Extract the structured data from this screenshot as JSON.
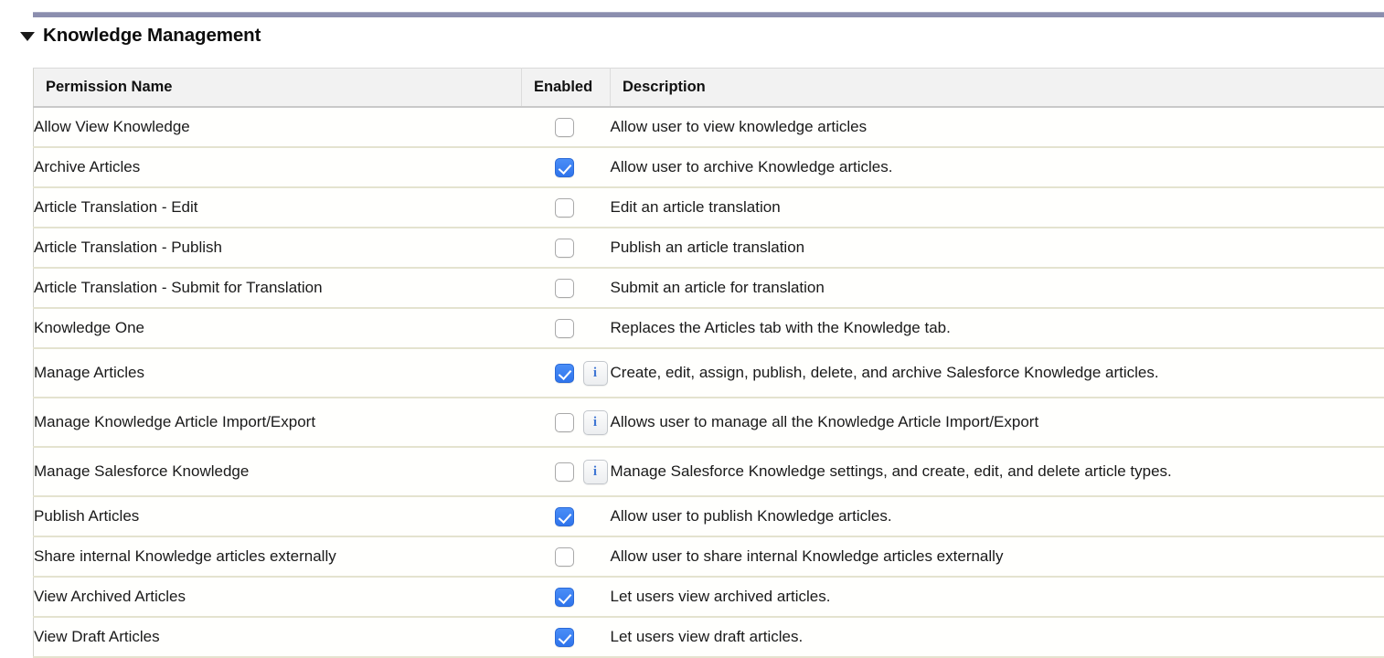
{
  "section": {
    "title": "Knowledge Management",
    "disclosure_icon": "triangle-down-icon",
    "expanded": true,
    "accent_color": "#8b8eae"
  },
  "table": {
    "columns": [
      {
        "key": "name",
        "label": "Permission Name"
      },
      {
        "key": "enabled",
        "label": "Enabled"
      },
      {
        "key": "description",
        "label": "Description"
      }
    ],
    "checkbox_checked_color": "#3b82f6",
    "info_icon_color": "#3f76d4",
    "row_divider_color": "#e4e3cf",
    "rows": [
      {
        "name": "Allow View Knowledge",
        "enabled": false,
        "has_info": false,
        "description": "Allow user to view knowledge articles"
      },
      {
        "name": "Archive Articles",
        "enabled": true,
        "has_info": false,
        "description": "Allow user to archive Knowledge articles."
      },
      {
        "name": "Article Translation - Edit",
        "enabled": false,
        "has_info": false,
        "description": "Edit an article translation"
      },
      {
        "name": "Article Translation - Publish",
        "enabled": false,
        "has_info": false,
        "description": "Publish an article translation"
      },
      {
        "name": "Article Translation - Submit for Translation",
        "enabled": false,
        "has_info": false,
        "description": "Submit an article for translation"
      },
      {
        "name": "Knowledge One",
        "enabled": false,
        "has_info": false,
        "description": "Replaces the Articles tab with the Knowledge tab."
      },
      {
        "name": "Manage Articles",
        "enabled": true,
        "has_info": true,
        "description": "Create, edit, assign, publish, delete, and archive Salesforce Knowledge articles."
      },
      {
        "name": "Manage Knowledge Article Import/Export",
        "enabled": false,
        "has_info": true,
        "description": "Allows user to manage all the Knowledge Article Import/Export"
      },
      {
        "name": "Manage Salesforce Knowledge",
        "enabled": false,
        "has_info": true,
        "description": "Manage Salesforce Knowledge settings, and create, edit, and delete article types."
      },
      {
        "name": "Publish Articles",
        "enabled": true,
        "has_info": false,
        "description": "Allow user to publish Knowledge articles."
      },
      {
        "name": "Share internal Knowledge articles externally",
        "enabled": false,
        "has_info": false,
        "description": "Allow user to share internal Knowledge articles externally"
      },
      {
        "name": "View Archived Articles",
        "enabled": true,
        "has_info": false,
        "description": "Let users view archived articles."
      },
      {
        "name": "View Draft Articles",
        "enabled": true,
        "has_info": false,
        "description": "Let users view draft articles."
      }
    ]
  },
  "icons": {
    "info_glyph": "i"
  }
}
